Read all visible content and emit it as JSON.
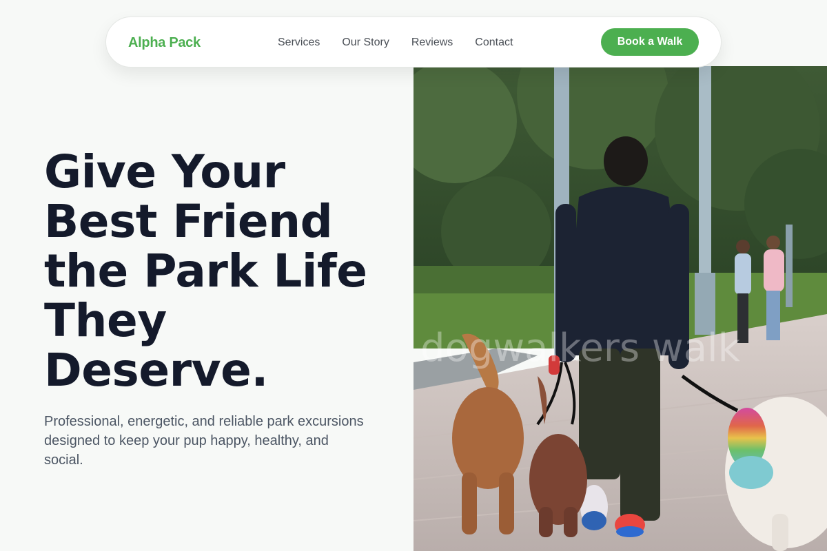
{
  "brand": {
    "name": "Alpha Pack",
    "color": "#4caf50"
  },
  "nav": {
    "links": [
      {
        "label": "Services"
      },
      {
        "label": "Our Story"
      },
      {
        "label": "Reviews"
      },
      {
        "label": "Contact"
      }
    ],
    "cta_label": "Book a Walk"
  },
  "hero": {
    "title_lines": [
      "Give Your",
      "Best Friend",
      "the Park Life",
      "They",
      "Deserve."
    ],
    "subtitle": "Professional, energetic, and reliable park excursions designed to keep your pup happy, healthy, and social.",
    "image": {
      "semantic": "photo of a person walking several dogs on leashes along a park boardwalk",
      "watermark_text": "dogwalkers walk"
    }
  },
  "colors": {
    "accent": "#4caf50",
    "heading": "#141a2b",
    "body_text": "#4b5563",
    "page_background": "#f7f9f7"
  }
}
